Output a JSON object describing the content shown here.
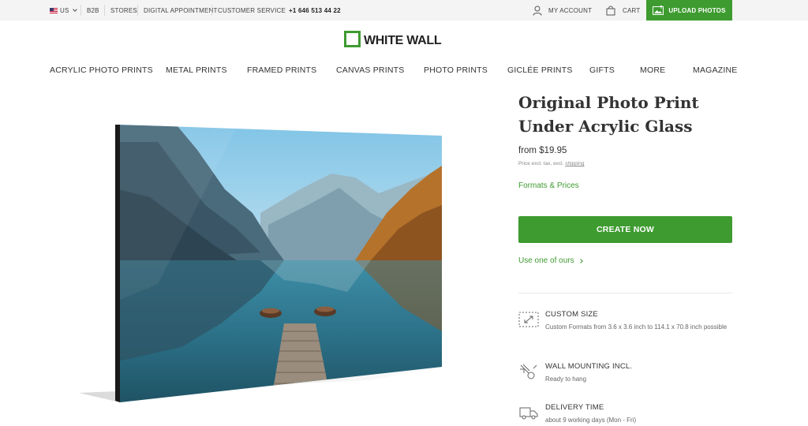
{
  "topbar": {
    "country": "US",
    "b2b": "B2B",
    "stores": "STORES",
    "appointment": "DIGITAL APPOINTMENT",
    "customer_service": "CUSTOMER SERVICE",
    "phone": "+1 646 513 44 22",
    "account": "MY ACCOUNT",
    "cart": "CART",
    "upload": "UPLOAD PHOTOS"
  },
  "logo": {
    "text": "WHITE WALL",
    "brand_color": "#3e9b30"
  },
  "nav": {
    "items": [
      "ACRYLIC PHOTO PRINTS",
      "METAL PRINTS",
      "FRAMED PRINTS",
      "CANVAS PRINTS",
      "PHOTO PRINTS",
      "GICLÉE PRINTS",
      "GIFTS",
      "MORE",
      "MAGAZINE"
    ]
  },
  "product": {
    "title_line1": "Original Photo Print",
    "title_line2": "Under Acrylic Glass",
    "price": "from $19.95",
    "price_note": "Price excl. tax, excl.",
    "price_note_link": "shipping",
    "formats_link": "Formats & Prices",
    "create_button": "CREATE NOW",
    "use_ours": "Use one of ours"
  },
  "features": [
    {
      "icon": "custom-size-icon",
      "title": "CUSTOM SIZE",
      "desc": "Custom Formats from 3.6 x 3.6 inch to 114.1 x 70.8 inch possible"
    },
    {
      "icon": "wall-mounting-icon",
      "title": "WALL MOUNTING INCL.",
      "desc": "Ready to hang"
    },
    {
      "icon": "delivery-truck-icon",
      "title": "DELIVERY TIME",
      "desc": "about 9 working days (Mon - Fri)"
    }
  ],
  "colors": {
    "accent": "#3e9b30",
    "topbar_bg": "#f4f4f4"
  }
}
